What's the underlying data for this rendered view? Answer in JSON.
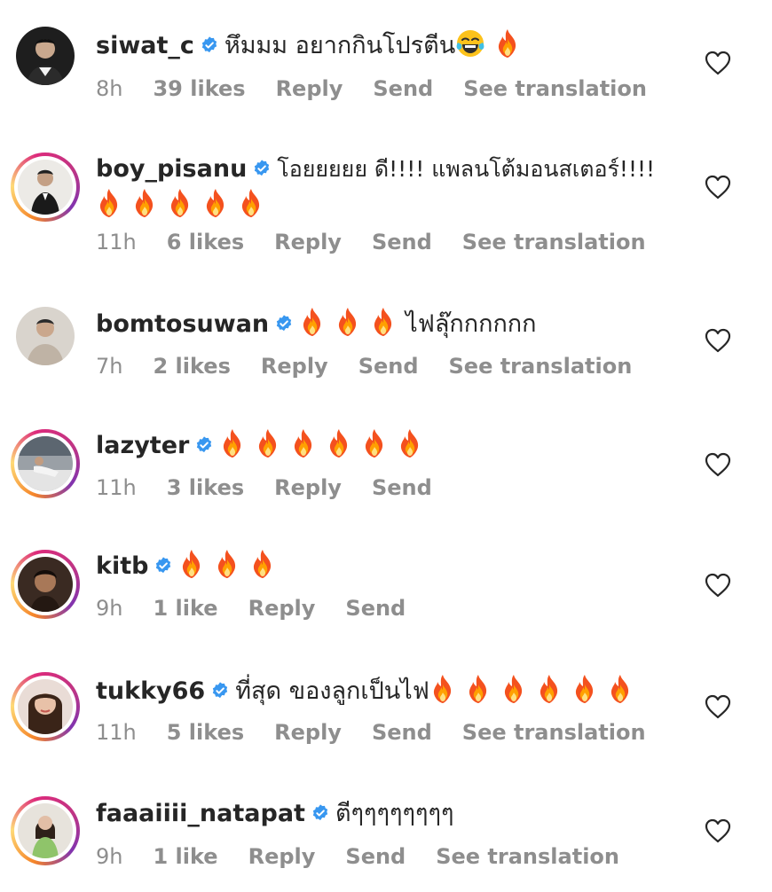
{
  "colors": {
    "text": "#262626",
    "meta": "#8e8e8e",
    "verified": "#3897f0"
  },
  "comments": [
    {
      "username": "siwat_c",
      "text": "หึมมม อยากกินโปรตีน",
      "emoji": [
        "laugh-cry-icon",
        "fire-icon"
      ],
      "time": "8h",
      "likes": "39 likes",
      "reply": "Reply",
      "send": "Send",
      "translation": "See translation"
    },
    {
      "username": "boy_pisanu",
      "text": "โอยยยยย ดี!!!! แพลนโต้มอนสเตอร์!!!!",
      "emoji_line2": [
        "fire-icon",
        "fire-icon",
        "fire-icon",
        "fire-icon",
        "fire-icon"
      ],
      "time": "11h",
      "likes": "6 likes",
      "reply": "Reply",
      "send": "Send",
      "translation": "See translation"
    },
    {
      "username": "bomtosuwan",
      "emoji": [
        "fire-icon",
        "fire-icon",
        "fire-icon"
      ],
      "text": "ไฟลุ๊กกกกกก",
      "time": "7h",
      "likes": "2 likes",
      "reply": "Reply",
      "send": "Send",
      "translation": "See translation"
    },
    {
      "username": "lazyter",
      "emoji": [
        "fire-icon",
        "fire-icon",
        "fire-icon",
        "fire-icon",
        "fire-icon",
        "fire-icon"
      ],
      "time": "11h",
      "likes": "3 likes",
      "reply": "Reply",
      "send": "Send"
    },
    {
      "username": "kitb",
      "emoji": [
        "fire-icon",
        "fire-icon",
        "fire-icon"
      ],
      "time": "9h",
      "likes": "1 like",
      "reply": "Reply",
      "send": "Send"
    },
    {
      "username": "tukky66",
      "text": "ที่สุด ของลูกเป็นไฟ",
      "emoji": [
        "fire-icon",
        "fire-icon",
        "fire-icon",
        "fire-icon",
        "fire-icon",
        "fire-icon"
      ],
      "time": "11h",
      "likes": "5 likes",
      "reply": "Reply",
      "send": "Send",
      "translation": "See translation"
    },
    {
      "username": "faaaiiii_natapat",
      "text": "ตีๆๆๆๆๆๆๆๆ",
      "time": "9h",
      "likes": "1 like",
      "reply": "Reply",
      "send": "Send",
      "translation": "See translation"
    }
  ]
}
